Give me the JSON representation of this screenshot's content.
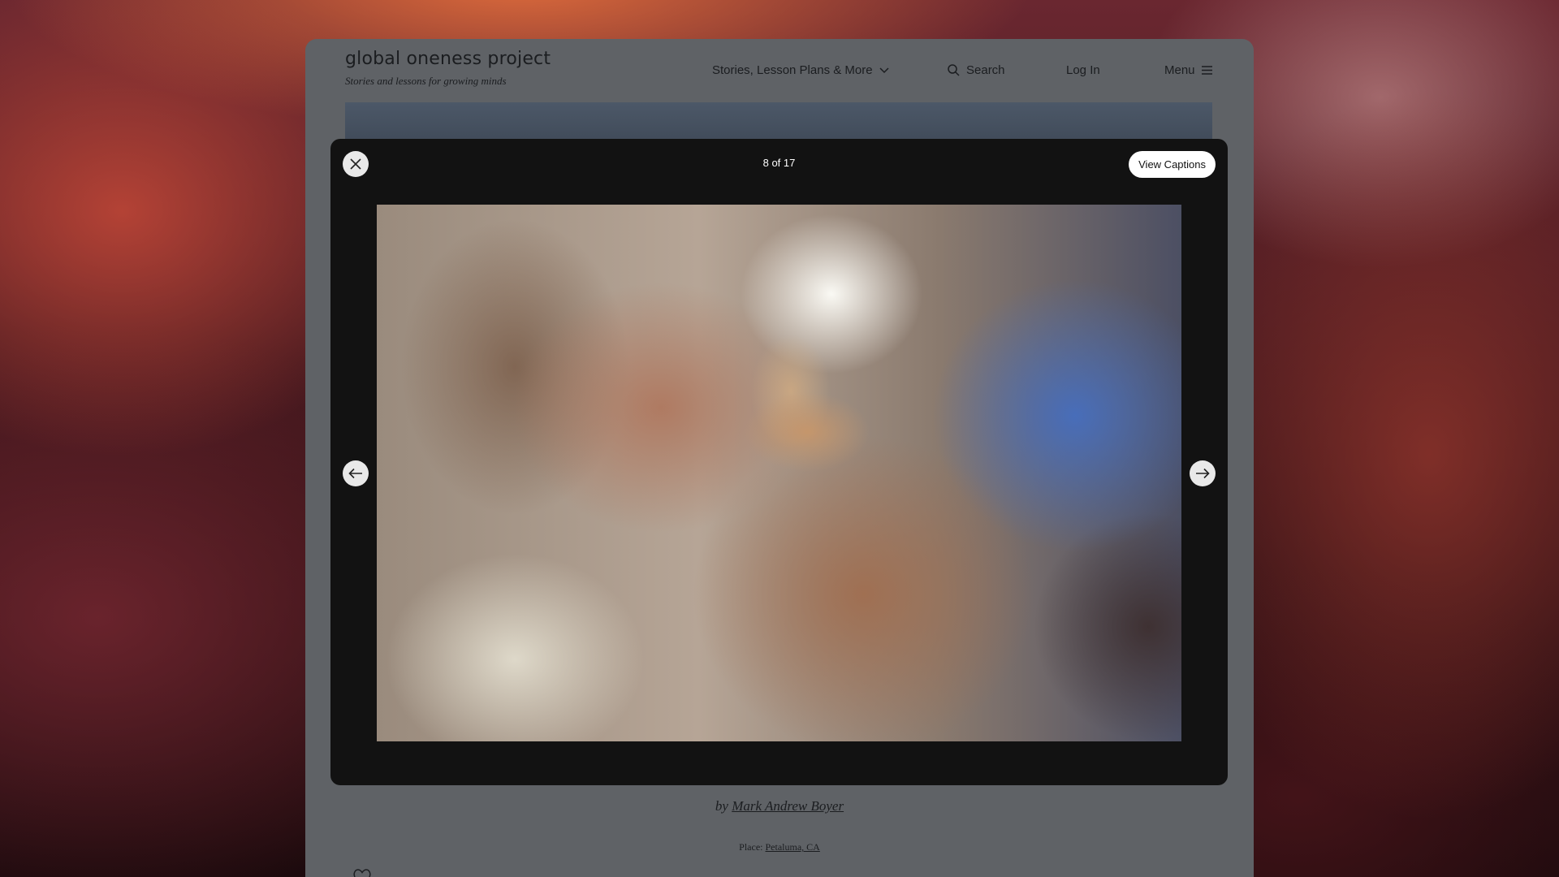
{
  "header": {
    "logo_title": "global oneness project",
    "logo_tagline": "Stories and lessons for growing minds",
    "nav": {
      "stories": "Stories, Lesson Plans & More",
      "search": "Search",
      "login": "Log In",
      "menu": "Menu"
    }
  },
  "modal": {
    "counter": "8 of 17",
    "view_captions": "View Captions"
  },
  "credit": {
    "prefix": "by",
    "author": "Mark Andrew Boyer"
  },
  "place": {
    "label": "Place:",
    "value": "Petaluma, CA"
  },
  "icons": {
    "close": "close-icon",
    "prev": "arrow-left-icon",
    "next": "arrow-right-icon",
    "search": "search-icon",
    "chevron": "chevron-down-icon",
    "menu": "hamburger-icon",
    "heart": "heart-icon"
  }
}
